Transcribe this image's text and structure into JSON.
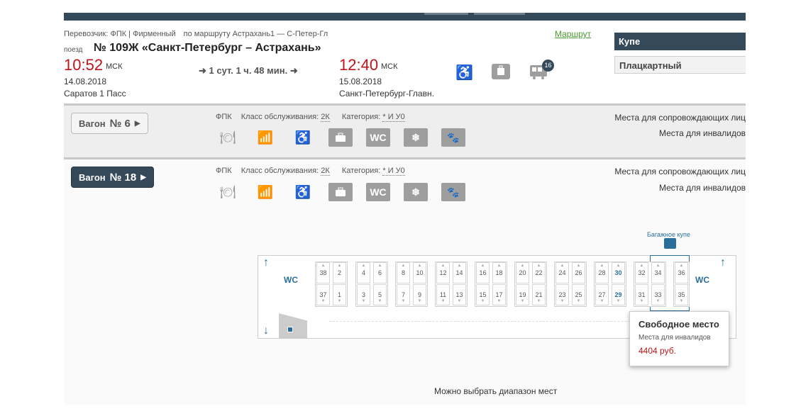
{
  "header": {
    "carrier_label": "Перевозчик: ФПК | Фирменный",
    "route_label": "по маршруту Астрахань1 — С-Петер-Гл",
    "route_link": "Маршрут",
    "train_prefix": "поезд",
    "train_name": "№ 109Ж «Санкт-Петербург – Астрахань»",
    "departure": {
      "time": "10:52",
      "tz": "МСК",
      "date": "14.08.2018",
      "station": "Саратов 1 Пасс"
    },
    "arrival": {
      "time": "12:40",
      "tz": "МСК",
      "date": "15.08.2018",
      "station": "Санкт-Петербург-Главн."
    },
    "duration": "1 сут. 1 ч. 48 мин.",
    "duration_arrow": "➜",
    "icons": [
      "wheelchair-icon",
      "luggage-icon",
      "cars-icon"
    ],
    "cars_badge": "16"
  },
  "class_tabs": [
    {
      "label": "Купе",
      "active": true
    },
    {
      "label": "Плацкартный",
      "active": false
    }
  ],
  "cars": [
    {
      "button_label": "Вагон",
      "number": "№ 6",
      "carrier": "ФПК",
      "service_class_label": "Класс обслуживания:",
      "service_class": "2К",
      "category_label": "Категория:",
      "category": "* И У0",
      "note1": "Места для сопровождающих лиц",
      "note2": "Места для инвалидов"
    },
    {
      "button_label": "Вагон",
      "number": "№ 18",
      "carrier": "ФПК",
      "service_class_label": "Класс обслуживания:",
      "service_class": "2К",
      "category_label": "Категория:",
      "category": "* И У0",
      "note1": "Места для сопровождающих лиц",
      "note2": "Места для инвалидов"
    }
  ],
  "amenities": [
    "meal-icon",
    "chart-icon",
    "wheelchair-icon",
    "luggage-icon",
    "wc-icon",
    "snowflake-icon",
    "pet-icon"
  ],
  "amenity_labels": {
    "wc": "WC",
    "snow": "❄",
    "pet": "🐾"
  },
  "scheme": {
    "wc_label": "WC",
    "baggage_label": "Багажное купе",
    "compartments": [
      {
        "top": [
          "38",
          "2"
        ],
        "bottom": [
          "37",
          "1"
        ]
      },
      {
        "top": [
          "4",
          "6"
        ],
        "bottom": [
          "3",
          "5"
        ]
      },
      {
        "top": [
          "8",
          "10"
        ],
        "bottom": [
          "7",
          "9"
        ]
      },
      {
        "top": [
          "12",
          "14"
        ],
        "bottom": [
          "11",
          "13"
        ]
      },
      {
        "top": [
          "16",
          "18"
        ],
        "bottom": [
          "15",
          "17"
        ]
      },
      {
        "top": [
          "20",
          "22"
        ],
        "bottom": [
          "19",
          "21"
        ]
      },
      {
        "top": [
          "24",
          "26"
        ],
        "bottom": [
          "23",
          "25"
        ]
      },
      {
        "top": [
          "28",
          "30"
        ],
        "bottom": [
          "27",
          "29"
        ]
      },
      {
        "top": [
          "32",
          "34"
        ],
        "bottom": [
          "31",
          "33"
        ]
      },
      {
        "top": [
          "36"
        ],
        "bottom": [
          "35"
        ]
      }
    ],
    "free_seats": [
      "30",
      "29"
    ]
  },
  "tooltip": {
    "title": "Свободное место",
    "subtitle": "Места для инвалидов",
    "price": "4404 руб."
  },
  "hint": "Можно выбрать диапазон мест"
}
